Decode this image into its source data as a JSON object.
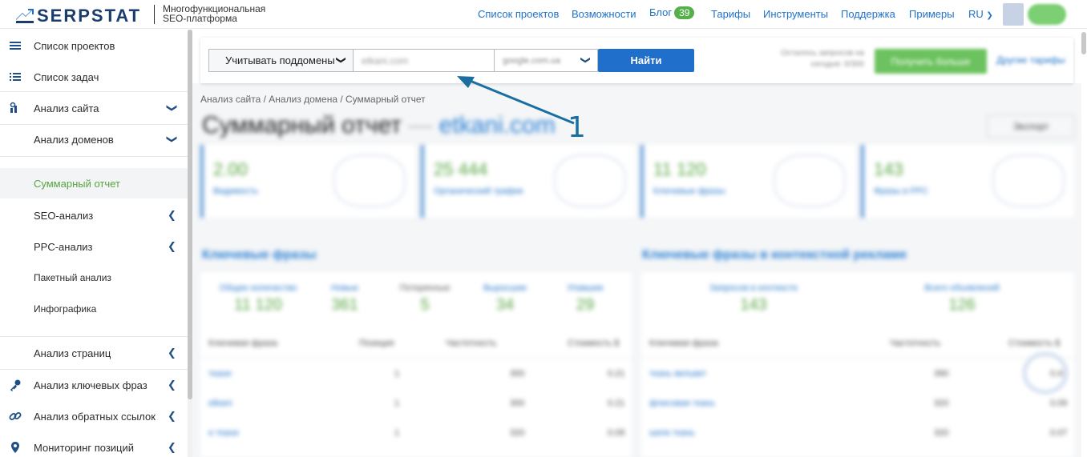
{
  "header": {
    "logo_text": "SERPSTAT",
    "tagline_line1": "Многофункциональная",
    "tagline_line2": "SEO-платформа",
    "nav": [
      {
        "label": "Список проектов"
      },
      {
        "label": "Возможности"
      },
      {
        "label": "Блог",
        "badge": "39"
      },
      {
        "label": "Тарифы"
      },
      {
        "label": "Инструменты"
      },
      {
        "label": "Поддержка"
      },
      {
        "label": "Примеры"
      }
    ],
    "language": "RU"
  },
  "sidebar": {
    "items": [
      {
        "label": "Список проектов",
        "icon": "menu-icon"
      },
      {
        "label": "Список задач",
        "icon": "task-list-icon"
      },
      {
        "label": "Анализ сайта",
        "icon": "site-analysis-icon"
      },
      {
        "label": "Анализ доменов"
      },
      {
        "label": "Суммарный отчет"
      },
      {
        "label": "SEO-анализ"
      },
      {
        "label": "PPC-анализ"
      },
      {
        "label": "Пакетный анализ"
      },
      {
        "label": "Инфографика"
      },
      {
        "label": "Анализ страниц"
      },
      {
        "label": "Анализ ключевых фраз",
        "icon": "key-icon"
      },
      {
        "label": "Анализ обратных ссылок",
        "icon": "link-icon"
      },
      {
        "label": "Мониторинг позиций",
        "icon": "pin-icon"
      }
    ]
  },
  "toolbar": {
    "subdomain_label": "Учитывать поддомены",
    "domain_value": "etkani.com",
    "database_value": "google.com.ua",
    "search_label": "Найти",
    "limit_text": "Осталось запросов на сегодня: 0/300",
    "upgrade_label": "Получить больше",
    "other_plans": "Другие тарифы"
  },
  "breadcrumb": "Анализ сайта / Анализ домена / Суммарный отчет",
  "page": {
    "title": "Суммарный отчет",
    "title_sep": "—",
    "domain": "etkani.com",
    "export_label": "Экспорт"
  },
  "cards": [
    {
      "value": "2.00",
      "label": "Видимость"
    },
    {
      "value": "25 444",
      "label": "Органический трафик"
    },
    {
      "value": "11 120",
      "label": "Ключевые фразы"
    },
    {
      "value": "143",
      "label": "Фразы в PPC"
    }
  ],
  "sections": {
    "left_title": "Ключевые фразы",
    "right_title": "Ключевые фразы в контекстной рекламе",
    "left_metrics": [
      {
        "label": "Общее количество",
        "value": "11 120"
      },
      {
        "label": "Новые",
        "value": "361"
      },
      {
        "label": "Потерянные",
        "value": "5"
      },
      {
        "label": "Выросшие",
        "value": "34"
      },
      {
        "label": "Упавшие",
        "value": "29"
      }
    ],
    "right_metrics": [
      {
        "label": "Запросов в контексте",
        "value": "143"
      },
      {
        "label": "Всего объявлений",
        "value": "126"
      }
    ],
    "left_columns": [
      "Ключевая фраза",
      "Позиция",
      "Частотность",
      "Стоимость $"
    ],
    "right_columns": [
      "Ключевая фраза",
      "Частотность",
      "Стоимость $"
    ],
    "left_rows": [
      {
        "phrase": "ткани",
        "pos": "1",
        "freq": "300",
        "cost": "0.21"
      },
      {
        "phrase": "etkani",
        "pos": "1",
        "freq": "300",
        "cost": "0.21"
      },
      {
        "phrase": "е ткани",
        "pos": "1",
        "freq": "320",
        "cost": "0.09"
      }
    ],
    "right_rows": [
      {
        "phrase": "ткань вельвет",
        "freq": "390",
        "cost": "0.41"
      },
      {
        "phrase": "флисовая ткань",
        "freq": "320",
        "cost": "0.09"
      },
      {
        "phrase": "шелк ткань",
        "freq": "320",
        "cost": "0.07"
      }
    ]
  },
  "annotation": {
    "number": "1"
  },
  "colors": {
    "accent": "#1f6fcb",
    "active_green": "#56a53f",
    "link": "#1f72c9"
  }
}
